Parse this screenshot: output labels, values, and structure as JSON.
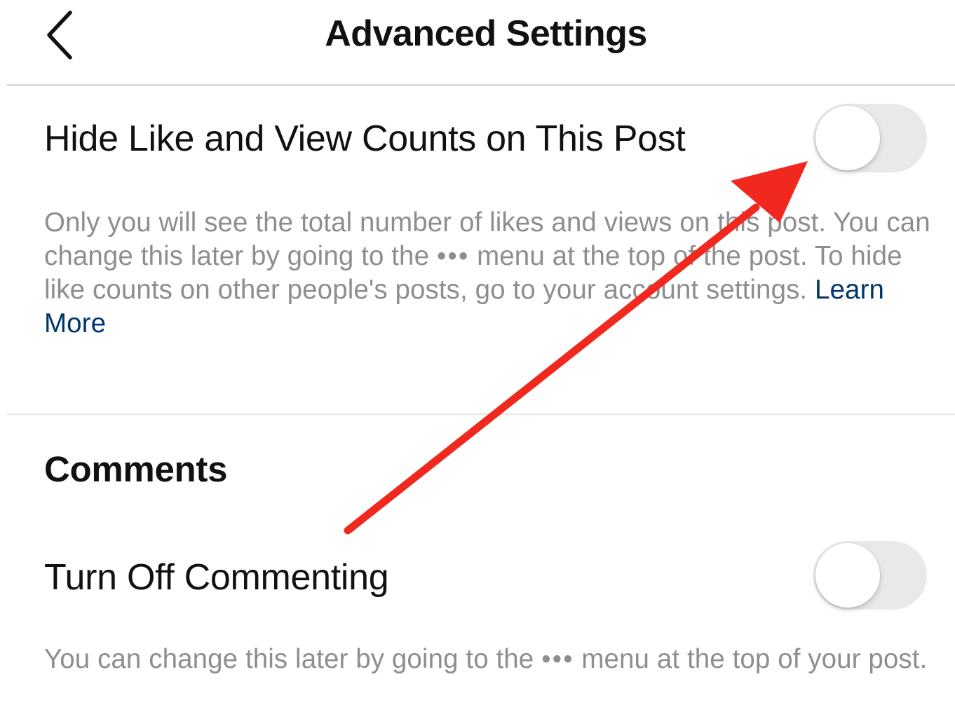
{
  "header": {
    "title": "Advanced Settings",
    "back_icon": "chevron-left-icon"
  },
  "hide_counts": {
    "title": "Hide Like and View Counts on This Post",
    "toggle_on": false,
    "description_part1": "Only you will see the total number of likes and views on this post. You can change this later by going to the ",
    "description_dots": "•••",
    "description_part2": " menu at the top of the post. To hide like counts on other people's posts, go to your account settings. ",
    "learn_more": "Learn More"
  },
  "comments": {
    "heading": "Comments",
    "title": "Turn Off Commenting",
    "toggle_on": false,
    "description_part1": "You can change this later by going to the ",
    "description_dots": "•••",
    "description_part2": " menu at the top of your post."
  },
  "annotation": {
    "arrow_color": "#f0281e"
  },
  "colors": {
    "toggle_off": "#e9e9ea",
    "link": "#00376b",
    "secondary_text": "#8e8e8e"
  }
}
